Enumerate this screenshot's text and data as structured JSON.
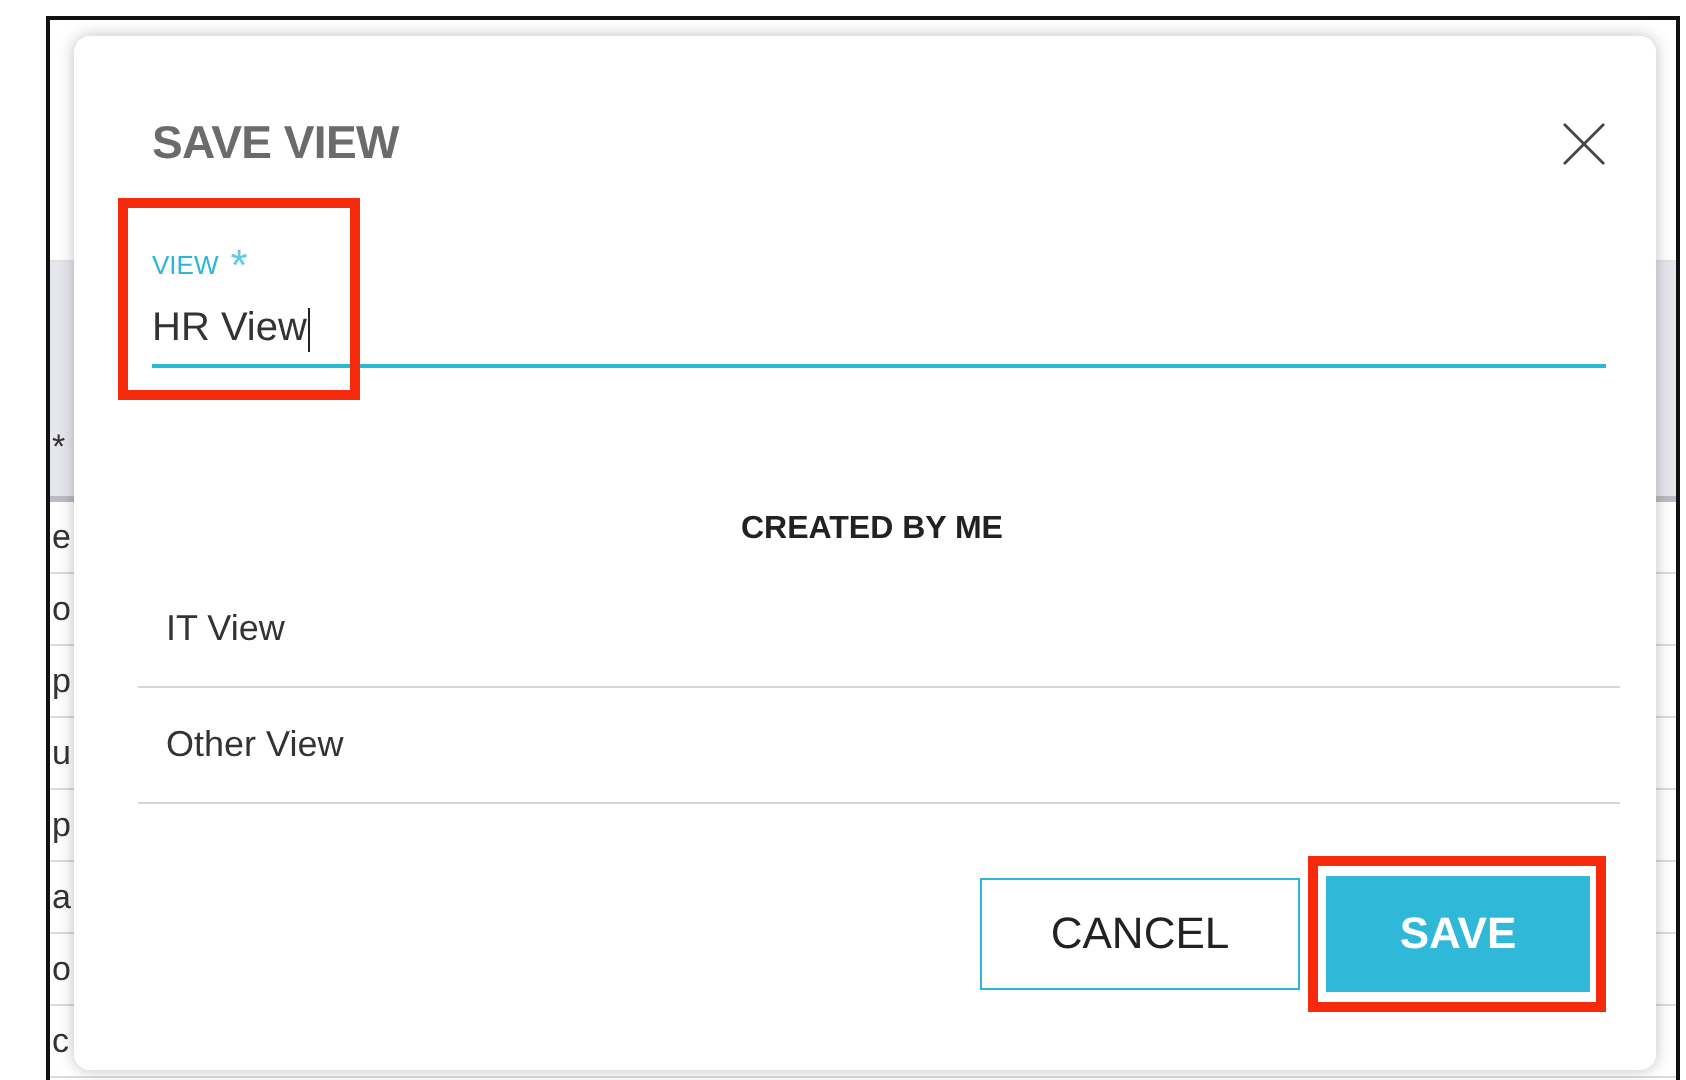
{
  "background_table": {
    "header_cell": "*",
    "rows": [
      "e",
      "o",
      "p",
      "u",
      "p",
      "a",
      "o",
      "c"
    ]
  },
  "dialog": {
    "title": "SAVE VIEW",
    "field": {
      "label": "VIEW",
      "required_mark": "*",
      "value": "HR View",
      "focused": true,
      "highlighted": true
    },
    "section_heading": "CREATED BY ME",
    "views": [
      {
        "name": "IT View"
      },
      {
        "name": "Other View"
      }
    ],
    "buttons": [
      {
        "label": "CANCEL",
        "kind": "secondary",
        "highlighted": false
      },
      {
        "label": "SAVE",
        "kind": "primary",
        "highlighted": true
      }
    ]
  }
}
